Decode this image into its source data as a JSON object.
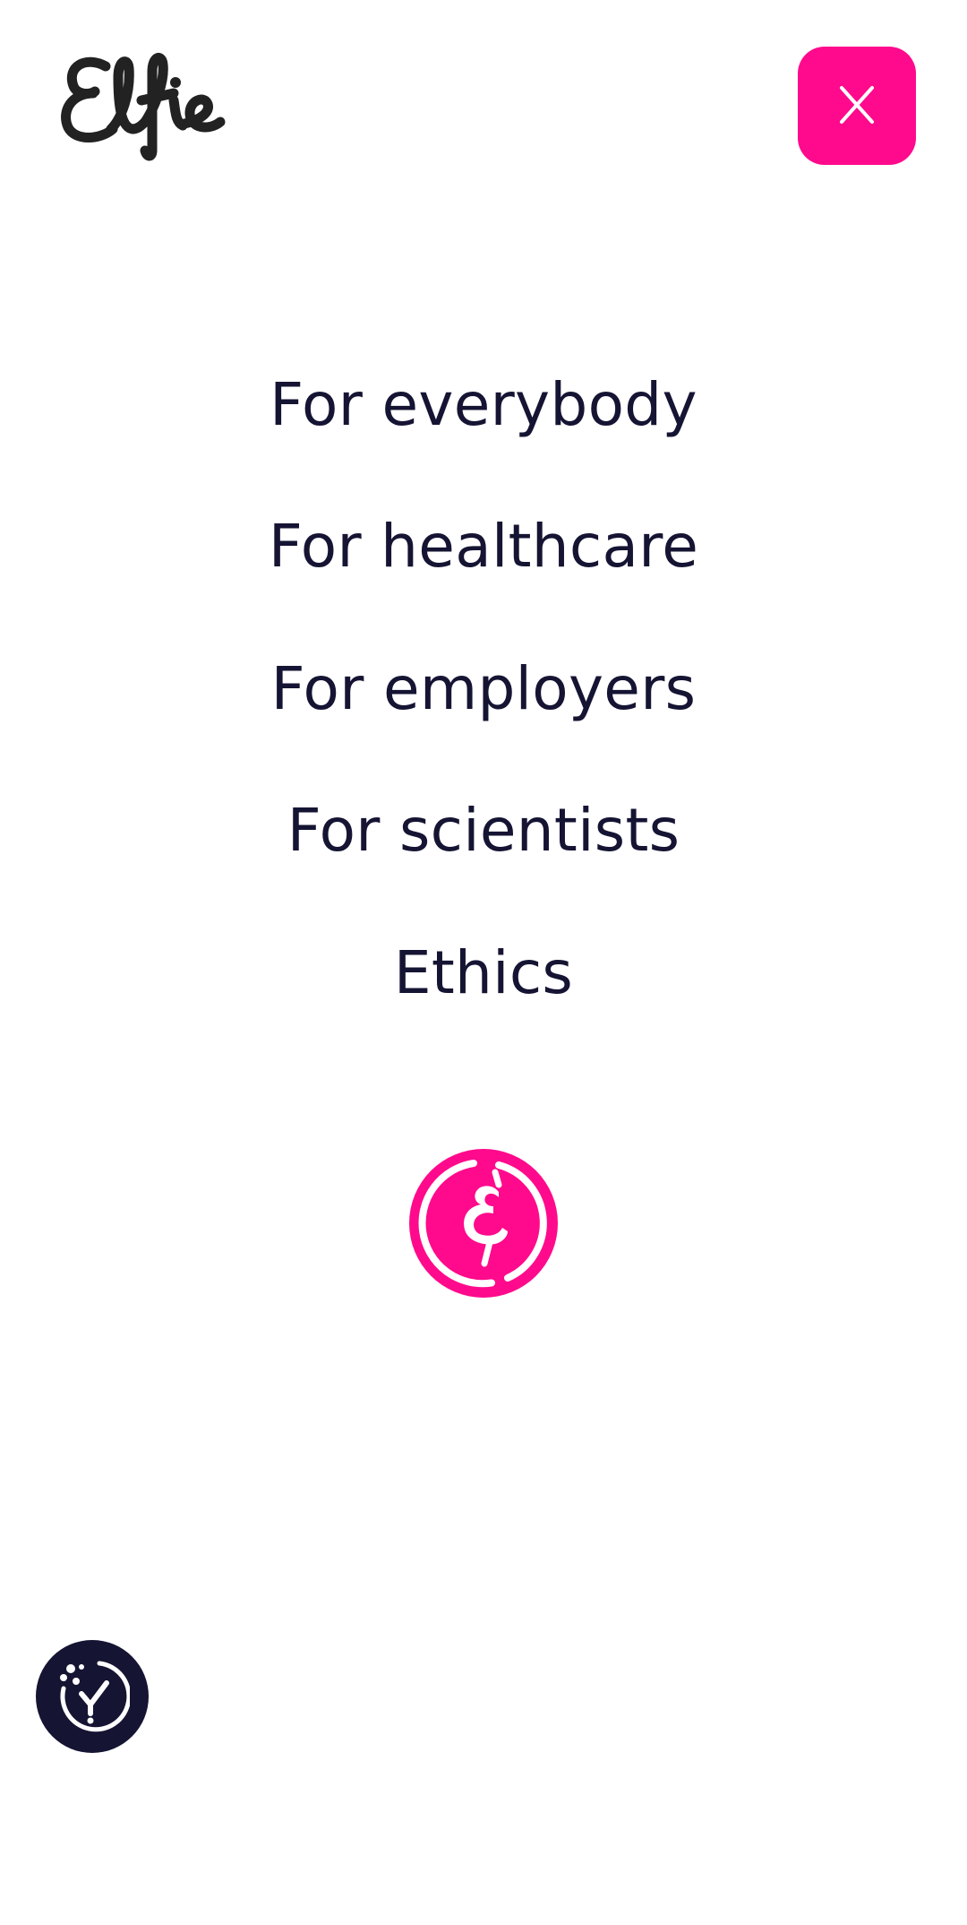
{
  "brand": {
    "logo_text": "Elfie",
    "logo_color": "#222222",
    "accent": "#ff0a8c",
    "dark": "#151433"
  },
  "header": {
    "close_icon": "close-icon"
  },
  "menu": {
    "items": [
      {
        "label": "For everybody"
      },
      {
        "label": "For healthcare"
      },
      {
        "label": "For employers"
      },
      {
        "label": "For scientists"
      },
      {
        "label": "Ethics"
      }
    ]
  },
  "emblem": {
    "icon": "elfie-coin-icon"
  },
  "cookie": {
    "icon": "cookie-consent-icon"
  }
}
